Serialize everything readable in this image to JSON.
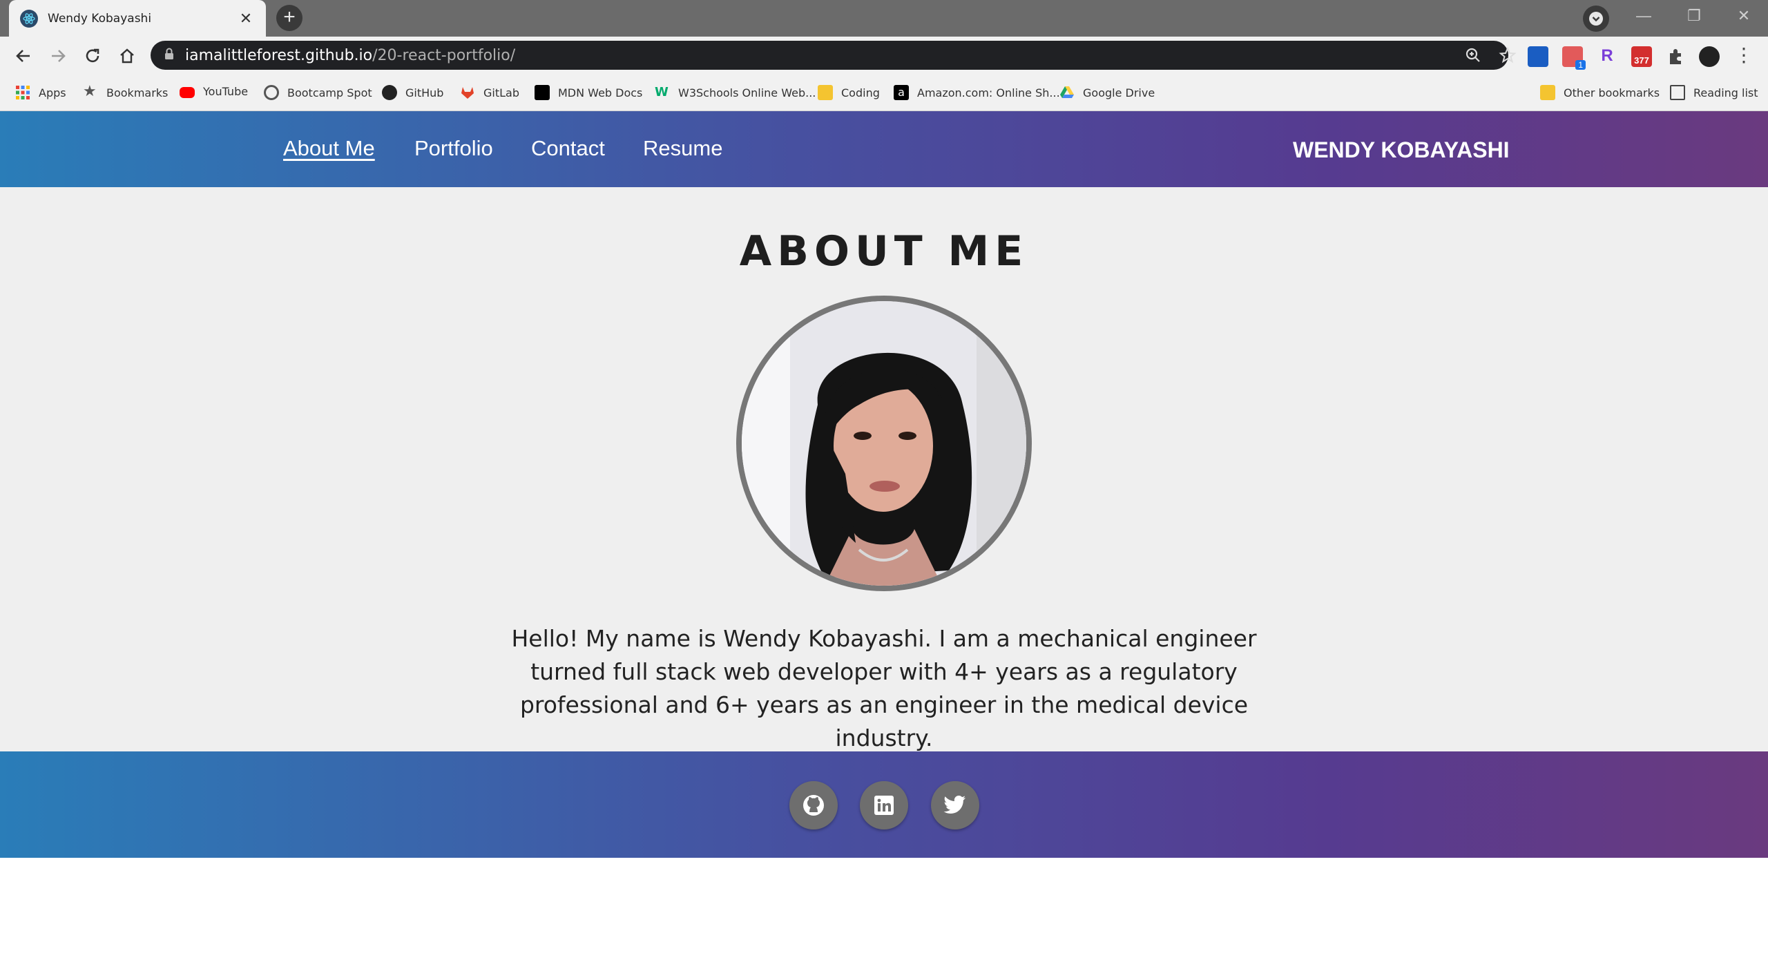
{
  "browser": {
    "tab_title": "Wendy Kobayashi",
    "url_host": "iamalittleforest.github.io",
    "url_path": "/20-react-portfolio/",
    "extension_badge": "377",
    "extension_badge_small": "1",
    "bookmarks": [
      {
        "label": "Apps",
        "icon": "apps-grid-icon",
        "color": "#e94235"
      },
      {
        "label": "Bookmarks",
        "icon": "star-icon",
        "color": "#555555"
      },
      {
        "label": "YouTube",
        "icon": "youtube-icon",
        "color": "#ff0000"
      },
      {
        "label": "Bootcamp Spot",
        "icon": "globe-icon",
        "color": "#555555"
      },
      {
        "label": "GitHub",
        "icon": "github-icon",
        "color": "#222222"
      },
      {
        "label": "GitLab",
        "icon": "gitlab-icon",
        "color": "#e24329"
      },
      {
        "label": "MDN Web Docs",
        "icon": "mdn-icon",
        "color": "#000000"
      },
      {
        "label": "W3Schools Online Web...",
        "icon": "w3schools-icon",
        "color": "#04aa6d"
      },
      {
        "label": "Coding",
        "icon": "folder-icon",
        "color": "#f4c430"
      },
      {
        "label": "Amazon.com: Online Sh...",
        "icon": "amazon-icon",
        "color": "#000000"
      },
      {
        "label": "Google Drive",
        "icon": "google-drive-icon",
        "color": "#1fa463"
      }
    ],
    "other_bookmarks": "Other bookmarks",
    "reading_list": "Reading list"
  },
  "site": {
    "nav": [
      "About Me",
      "Portfolio",
      "Contact",
      "Resume"
    ],
    "active_nav": "About Me",
    "brand": "WENDY KOBAYASHI",
    "heading": "ABOUT ME",
    "bio": "Hello! My name is Wendy Kobayashi. I am a mechanical engineer turned full stack web developer with 4+ years as a regulatory professional and 6+ years as an engineer in the medical device industry.",
    "social": [
      "github-icon",
      "linkedin-icon",
      "twitter-icon"
    ]
  },
  "colors": {
    "gradient_start": "#2a7db8",
    "gradient_end": "#6a3a7f",
    "social_button": "#6e6e6e",
    "page_background": "#efefef"
  }
}
